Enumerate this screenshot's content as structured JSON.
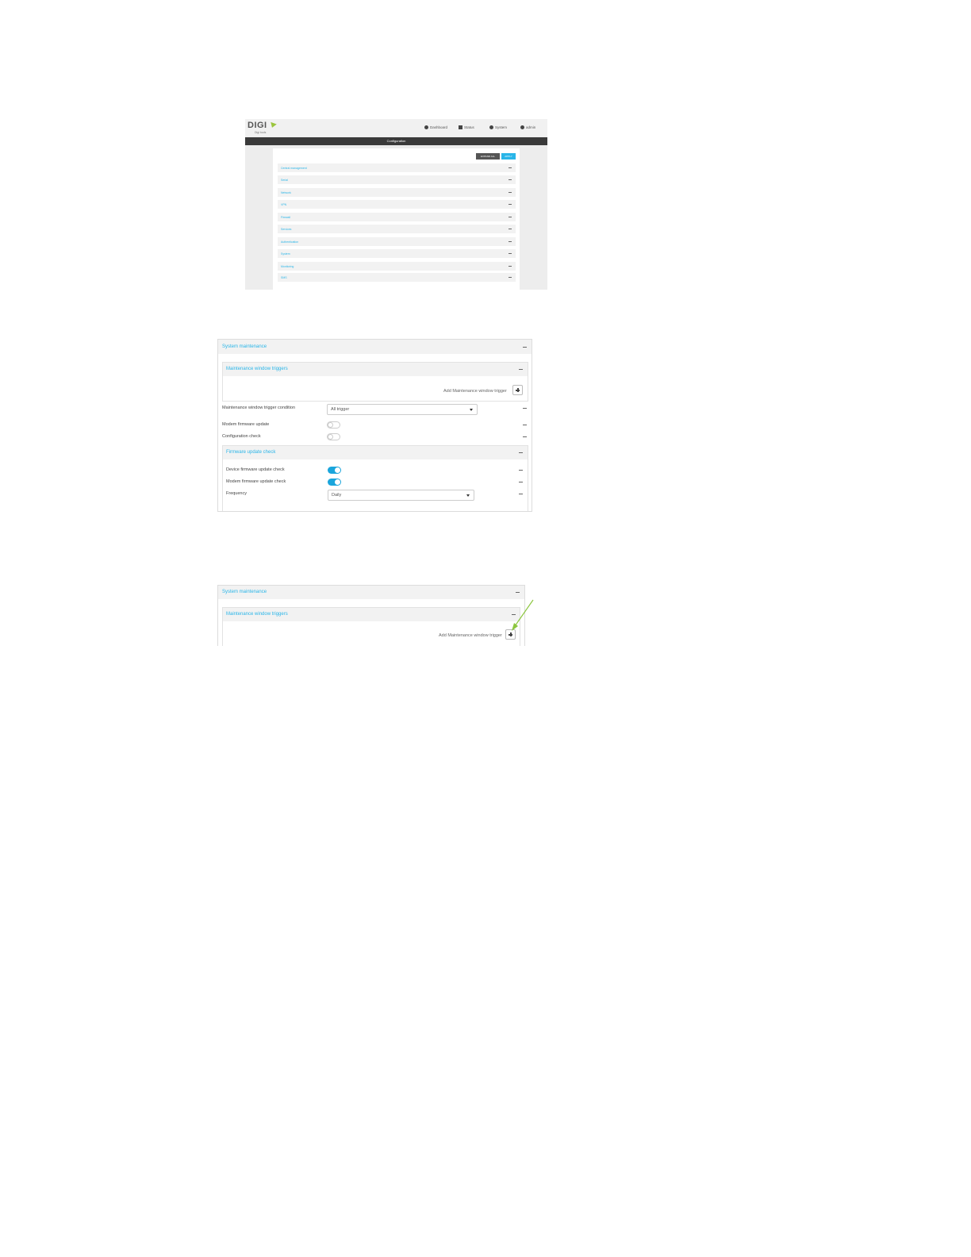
{
  "screenshot1": {
    "logo": {
      "text": "DIGI",
      "subtext": "Digi tools"
    },
    "nav": [
      {
        "label": "Dashboard",
        "icon": "dashboard-icon"
      },
      {
        "label": "Status",
        "icon": "grid-icon"
      },
      {
        "label": "System",
        "icon": "gear-icon"
      },
      {
        "label": "admin",
        "icon": "user-icon"
      }
    ],
    "page_title": "Configuration",
    "buttons": {
      "expand_all": "EXPAND ALL",
      "apply": "APPLY"
    },
    "sections": [
      "Central management",
      "Serial",
      "Network",
      "VPN",
      "Firewall",
      "Services",
      "Authentication",
      "System",
      "Monitoring",
      "SMS"
    ],
    "colors": {
      "accent": "#29b5e8",
      "header_dark": "#3a3a3a"
    }
  },
  "screenshot2": {
    "system_maintenance": "System maintenance",
    "maintenance_window_triggers": "Maintenance window triggers",
    "add_trigger_label": "Add Maintenance window trigger",
    "trigger_condition_label": "Maintenance window trigger condition",
    "trigger_condition_value": "All trigger",
    "modem_firmware_update_label": "Modem firmware update",
    "modem_firmware_update_on": false,
    "configuration_check_label": "Configuration check",
    "configuration_check_on": false,
    "firmware_update_check": "Firmware update check",
    "device_firmware_update_check_label": "Device firmware update check",
    "device_firmware_update_check_on": true,
    "modem_firmware_update_check_label": "Modem firmware update check",
    "modem_firmware_update_check_on": true,
    "frequency_label": "Frequency",
    "frequency_value": "Daily"
  },
  "screenshot3": {
    "system_maintenance": "System maintenance",
    "maintenance_window_triggers": "Maintenance window triggers",
    "add_trigger_label": "Add Maintenance window trigger",
    "arrow_color": "#8cc63f"
  }
}
